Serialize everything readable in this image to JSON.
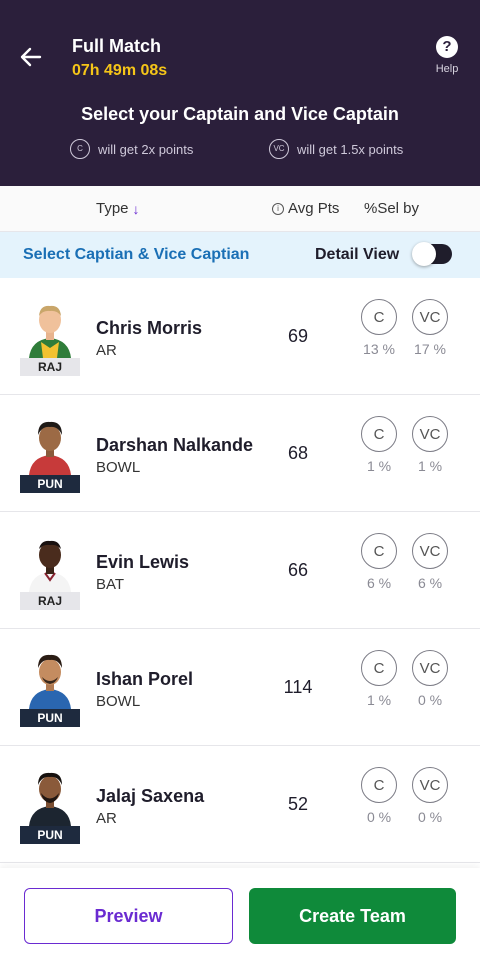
{
  "header": {
    "back_icon": "arrow-left-icon",
    "match_title": "Full Match",
    "timer": "07h 49m 08s",
    "help_label": "Help",
    "help_icon": "question-icon",
    "select_title": "Select your Captain and Vice Captain",
    "captain_badge": "C",
    "captain_hint": "will get 2x points",
    "vice_badge": "VC",
    "vice_hint": "will get 1.5x points",
    "colors": {
      "background": "#2b1f3b",
      "timer": "#f5c518"
    }
  },
  "columns": {
    "type": "Type",
    "type_sort_icon": "arrow-down-icon",
    "avg_pts": "Avg Pts",
    "info_icon": "info-icon",
    "sel_by": "%Sel by"
  },
  "info_bar": {
    "text": "Select Captian & Vice Captian",
    "detail_view_label": "Detail View",
    "detail_view_on": true
  },
  "players": [
    {
      "name": "Chris Morris",
      "role": "AR",
      "team": "RAJ",
      "avg_pts": "69",
      "c_label": "C",
      "vc_label": "VC",
      "c_pct": "13 %",
      "vc_pct": "17 %"
    },
    {
      "name": "Darshan Nalkande",
      "role": "BOWL",
      "team": "PUN",
      "avg_pts": "68",
      "c_label": "C",
      "vc_label": "VC",
      "c_pct": "1 %",
      "vc_pct": "1 %"
    },
    {
      "name": "Evin Lewis",
      "role": "BAT",
      "team": "RAJ",
      "avg_pts": "66",
      "c_label": "C",
      "vc_label": "VC",
      "c_pct": "6 %",
      "vc_pct": "6 %"
    },
    {
      "name": "Ishan Porel",
      "role": "BOWL",
      "team": "PUN",
      "avg_pts": "114",
      "c_label": "C",
      "vc_label": "VC",
      "c_pct": "1 %",
      "vc_pct": "0 %"
    },
    {
      "name": "Jalaj Saxena",
      "role": "AR",
      "team": "PUN",
      "avg_pts": "52",
      "c_label": "C",
      "vc_label": "VC",
      "c_pct": "0 %",
      "vc_pct": "0 %"
    }
  ],
  "footer": {
    "preview_label": "Preview",
    "create_team_label": "Create Team",
    "colors": {
      "preview": "#6a2bd1",
      "create": "#0f8a3a"
    }
  }
}
